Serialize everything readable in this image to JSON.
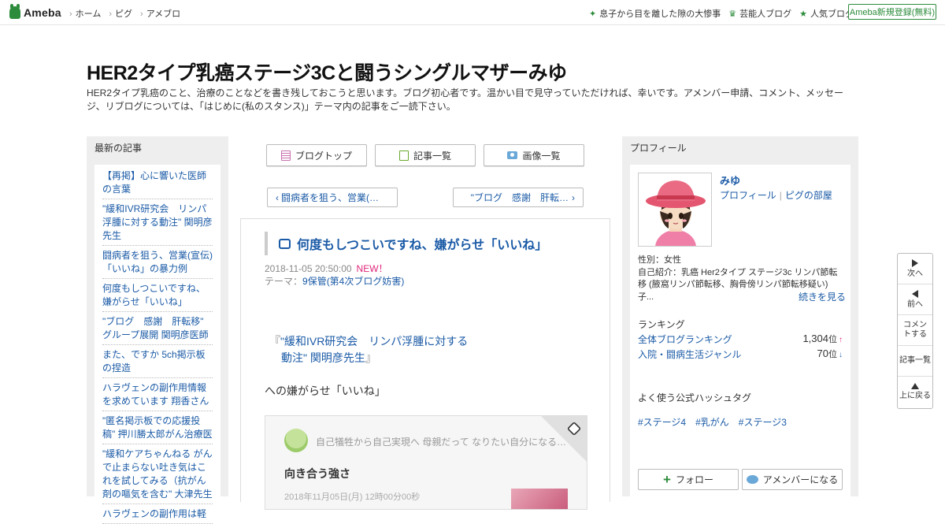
{
  "topbar": {
    "logo": "Ameba",
    "nav": [
      "ホーム",
      "ピグ",
      "アメブロ"
    ],
    "links": [
      {
        "icon": "sparkle-icon",
        "label": "息子から目を離した隙の大惨事"
      },
      {
        "icon": "crown-icon",
        "label": "芸能人ブログ"
      },
      {
        "icon": "star-icon",
        "label": "人気ブログ"
      }
    ],
    "signup": "Ameba新規登録(無料)"
  },
  "header": {
    "title": "HER2タイプ乳癌ステージ3Cと闘うシングルマザーみゆ",
    "description": "HER2タイプ乳癌のこと、治療のことなどを書き残しておこうと思います。ブログ初心者です。温かい目で見守っていただければ、幸いです。アメンバー申請、コメント、メッセージ、リブログについては、「はじめに(私のスタンス)」テーマ内の記事をご一読下さい。"
  },
  "left": {
    "heading": "最新の記事",
    "items": [
      "【再掲】心に響いた医師の言葉",
      "\"緩和IVR研究会　リンパ浮腫に対する動注\" 関明彦先生",
      "闘病者を狙う、営業(宣伝)「いいね」の暴力例",
      "何度もしつこいですね、嫌がらせ「いいね」",
      "\"ブログ　感謝　肝転移\" グループ展開 関明彦医師",
      "また、ですか 5ch掲示板の捏造",
      "ハラヴェンの副作用情報を求めています 翔香さん",
      "\"匿名掲示板での応援投稿\" 押川勝太郎がん治療医",
      "\"緩和ケアちゃんねる がんで止まらない吐き気はこれを試してみる（抗がん剤の嘔気を含む\" 大津先生",
      "ハラヴェンの副作用は軽"
    ]
  },
  "toolbar": {
    "blog_top": "ブログトップ",
    "articles": "記事一覧",
    "images": "画像一覧"
  },
  "pager": {
    "prev": "闘病者を狙う、営業(…",
    "next": "\"ブログ　感謝　肝転…"
  },
  "article": {
    "title": "何度もしつこいですね、嫌がらせ「いいね」",
    "date": "2018-11-05 20:50:00",
    "new_badge": "NEW！",
    "theme_prefix": "テーマ：",
    "theme": "9保管(第4次ブログ妨害)",
    "quote_open": "『",
    "quote_line1": "\"緩和IVR研究会　リンパ浮腫に対する",
    "quote_line2": "動注\"  関明彦先生",
    "quote_close": "』",
    "body": "への嫌がらせ「いいね」",
    "card": {
      "user": "自己犠牲から自己実現へ 母親だって なりたい自分になる…",
      "title": "向き合う強さ",
      "date": "2018年11月05日(月) 12時00分00秒"
    }
  },
  "profile": {
    "heading": "プロフィール",
    "name": "みゆ",
    "link_profile": "プロフィール",
    "link_pig": "ピグの部屋",
    "gender": "性別：女性",
    "intro": "自己紹介：乳癌 Her2タイプ ステージ3c リンパ節転移 (腋窩リンパ節転移、胸骨傍リンパ節転移疑い) 子...",
    "more": "続きを見る",
    "ranking_heading": "ランキング",
    "ranks": [
      {
        "label": "全体ブログランキング",
        "value": "1,304",
        "unit": "位",
        "trend": "↑"
      },
      {
        "label": "入院・闘病生活ジャンル",
        "value": "70",
        "unit": "位",
        "trend": "↓"
      }
    ],
    "tags_heading": "よく使う公式ハッシュタグ",
    "tags": [
      "#ステージ4",
      "#乳がん",
      "#ステージ3"
    ],
    "follow": "フォロー",
    "amember": "アメンバーになる"
  },
  "floatnav": {
    "next": "次へ",
    "prev": "前へ",
    "comment": "コメントする",
    "list": "記事一覧",
    "top": "上に戻る"
  }
}
